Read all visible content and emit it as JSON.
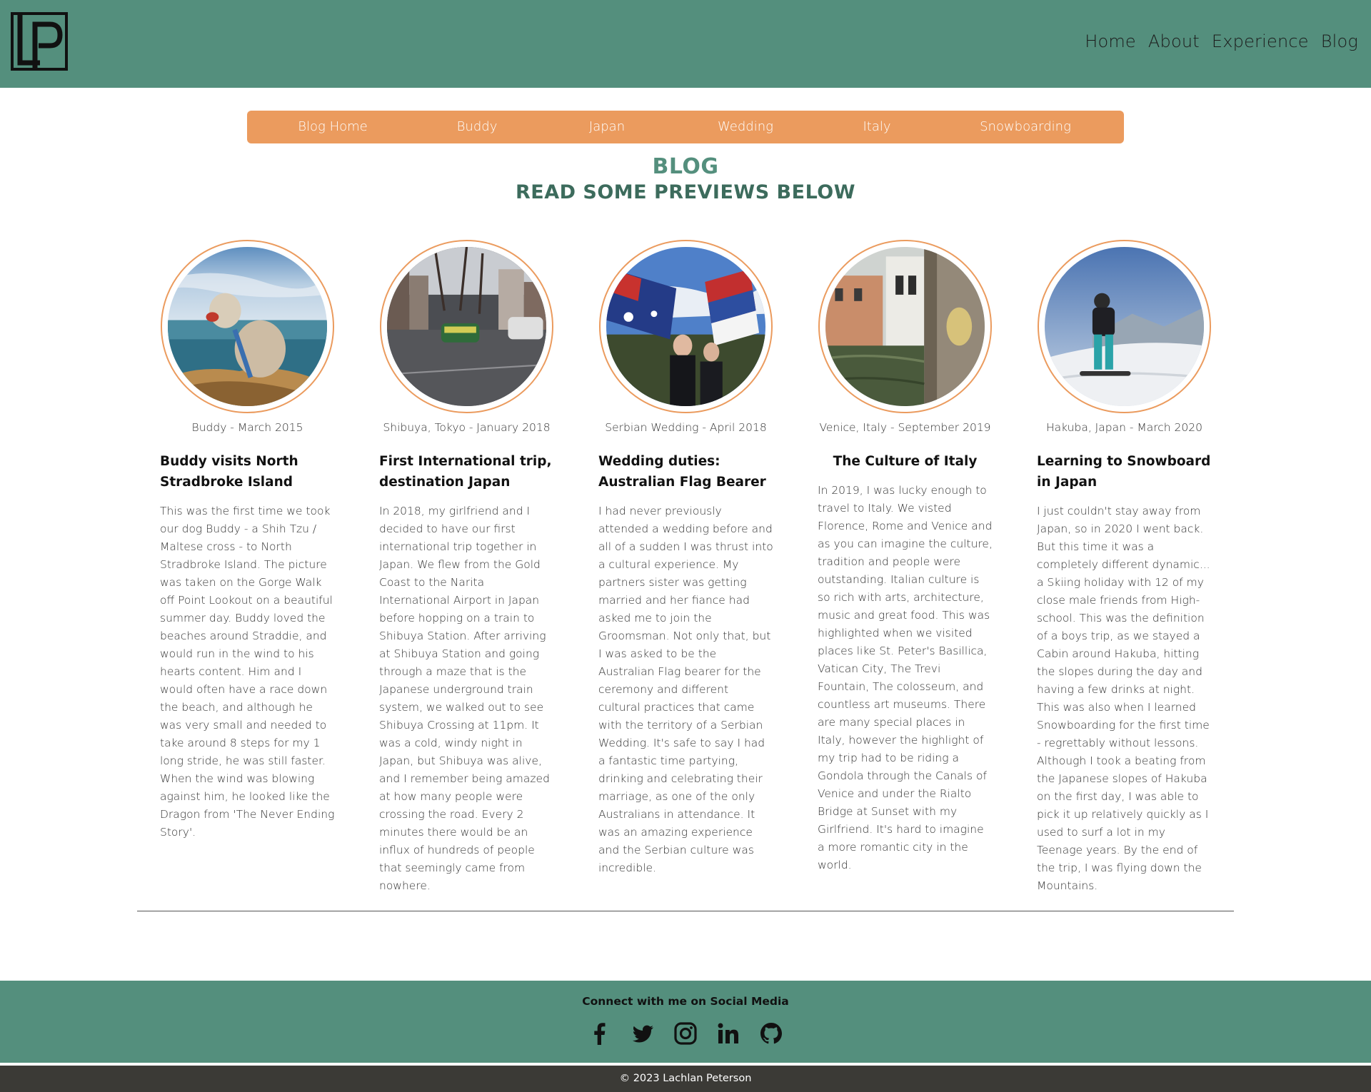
{
  "header": {
    "logo_alt": "LP",
    "nav": [
      "Home",
      "About",
      "Experience",
      "Blog"
    ]
  },
  "blog_nav": [
    "Blog Home",
    "Buddy",
    "Japan",
    "Wedding",
    "Italy",
    "Snowboarding"
  ],
  "title": "BLOG",
  "subtitle": "READ SOME PREVIEWS BELOW",
  "cards": [
    {
      "caption": "Buddy - March 2015",
      "title": "Buddy visits North Stradbroke Island",
      "text": "This was the first time we took our dog Buddy - a Shih Tzu / Maltese cross - to North Stradbroke Island. The picture was taken on the Gorge Walk off Point Lookout on a beautiful summer day. Buddy loved the beaches around Straddie, and would run in the wind to his hearts content. Him and I would often have a race down the beach, and although he was very small and needed to take around 8 steps for my 1 long stride, he was still faster. When the wind was blowing against him, he looked like the Dragon from 'The Never Ending Story'."
    },
    {
      "caption": "Shibuya, Tokyo - January 2018",
      "title": "First International trip, destination Japan",
      "text": "In 2018, my girlfriend and I decided to have our first international trip together in Japan. We flew from the Gold Coast to the Narita International Airport in Japan before hopping on a train to Shibuya Station. After arriving at Shibuya Station and going through a maze that is the Japanese underground train system, we walked out to see Shibuya Crossing at 11pm. It was a cold, windy night in Japan, but Shibuya was alive, and I remember being amazed at how many people were crossing the road. Every 2 minutes there would be an influx of hundreds of people that seemingly came from nowhere."
    },
    {
      "caption": "Serbian Wedding - April 2018",
      "title": "Wedding duties: Australian Flag Bearer",
      "text": "I had never previously attended a wedding before and all of a sudden I was thrust into a cultural experience. My partners sister was getting married and her fiance had asked me to join the Groomsman. Not only that, but I was asked to be the Australian Flag bearer for the ceremony and different cultural practices that came with the territory of a Serbian Wedding. It's safe to say I had a fantastic time partying, drinking and celebrating their marriage, as one of the only Australians in attendance. It was an amazing experience and the Serbian culture was incredible."
    },
    {
      "caption": "Venice, Italy - September 2019",
      "title": "The Culture of Italy",
      "text": "In 2019, I was lucky enough to travel to Italy. We visted Florence, Rome and Venice and as you can imagine the culture, tradition and people were outstanding. Italian culture is so rich with arts, architecture, music and great food. This was highlighted when we visited places like St. Peter's Basillica, Vatican City, The Trevi Fountain, The colosseum, and countless art museums. There are many special places in Italy, however the highlight of my trip had to be riding a Gondola through the Canals of Venice and under the Rialto Bridge at Sunset with my Girlfriend. It's hard to imagine a more romantic city in the world."
    },
    {
      "caption": "Hakuba, Japan - March 2020",
      "title": "Learning to Snowboard in Japan",
      "text": "I just couldn't stay away from Japan, so in 2020 I went back. But this time it was a completely different dynamic... a Skiing holiday with 12 of my close male friends from High-school. This was the definition of a boys trip, as we stayed a Cabin around Hakuba, hitting the slopes during the day and having a few drinks at night. This was also when I learned Snowboarding for the first time - regrettably without lessons. Although I took a beating from the Japanese slopes of Hakuba on the first day, I was able to pick it up relatively quickly as I used to surf a lot in my Teenage years. By the end of the trip, I was flying down the Mountains."
    }
  ],
  "footer": {
    "title": "Connect with me on Social Media",
    "social": [
      "facebook-icon",
      "twitter-icon",
      "instagram-icon",
      "linkedin-icon",
      "github-icon"
    ],
    "copyright": "© 2023 Lachlan Peterson"
  },
  "colors": {
    "header_bg": "#548f7d",
    "accent_orange": "#eb9b5e",
    "footer_bottom": "#3b3a36"
  }
}
